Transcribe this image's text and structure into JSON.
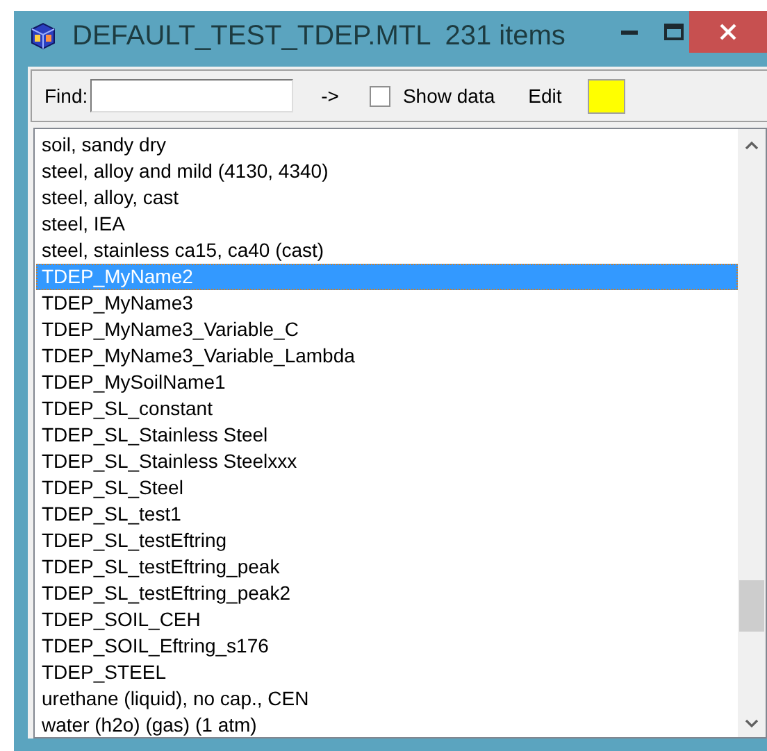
{
  "window": {
    "title": "DEFAULT_TEST_TDEP.MTL",
    "item_count": "231 items"
  },
  "toolbar": {
    "find_label": "Find:",
    "go_button": "->",
    "show_data": {
      "label": "Show data",
      "checked": false
    },
    "edit_button": "Edit"
  },
  "list": {
    "items": [
      {
        "label": "soil, sandy dry",
        "selected": false
      },
      {
        "label": "steel, alloy and mild (4130, 4340)",
        "selected": false
      },
      {
        "label": "steel, alloy, cast",
        "selected": false
      },
      {
        "label": "steel, IEA",
        "selected": false
      },
      {
        "label": "steel, stainless ca15, ca40 (cast)",
        "selected": false
      },
      {
        "label": "TDEP_MyName2",
        "selected": true
      },
      {
        "label": "TDEP_MyName3",
        "selected": false
      },
      {
        "label": "TDEP_MyName3_Variable_C",
        "selected": false
      },
      {
        "label": "TDEP_MyName3_Variable_Lambda",
        "selected": false
      },
      {
        "label": "TDEP_MySoilName1",
        "selected": false
      },
      {
        "label": "TDEP_SL_constant",
        "selected": false
      },
      {
        "label": "TDEP_SL_Stainless Steel",
        "selected": false
      },
      {
        "label": "TDEP_SL_Stainless Steelxxx",
        "selected": false
      },
      {
        "label": "TDEP_SL_Steel",
        "selected": false
      },
      {
        "label": "TDEP_SL_test1",
        "selected": false
      },
      {
        "label": "TDEP_SL_testEftring",
        "selected": false
      },
      {
        "label": "TDEP_SL_testEftring_peak",
        "selected": false
      },
      {
        "label": "TDEP_SL_testEftring_peak2",
        "selected": false
      },
      {
        "label": "TDEP_SOIL_CEH",
        "selected": false
      },
      {
        "label": "TDEP_SOIL_Eftring_s176",
        "selected": false
      },
      {
        "label": "TDEP_STEEL",
        "selected": false
      },
      {
        "label": "urethane (liquid), no cap., CEN",
        "selected": false
      },
      {
        "label": "water (h2o) (gas) (1 atm)",
        "selected": false
      }
    ]
  }
}
